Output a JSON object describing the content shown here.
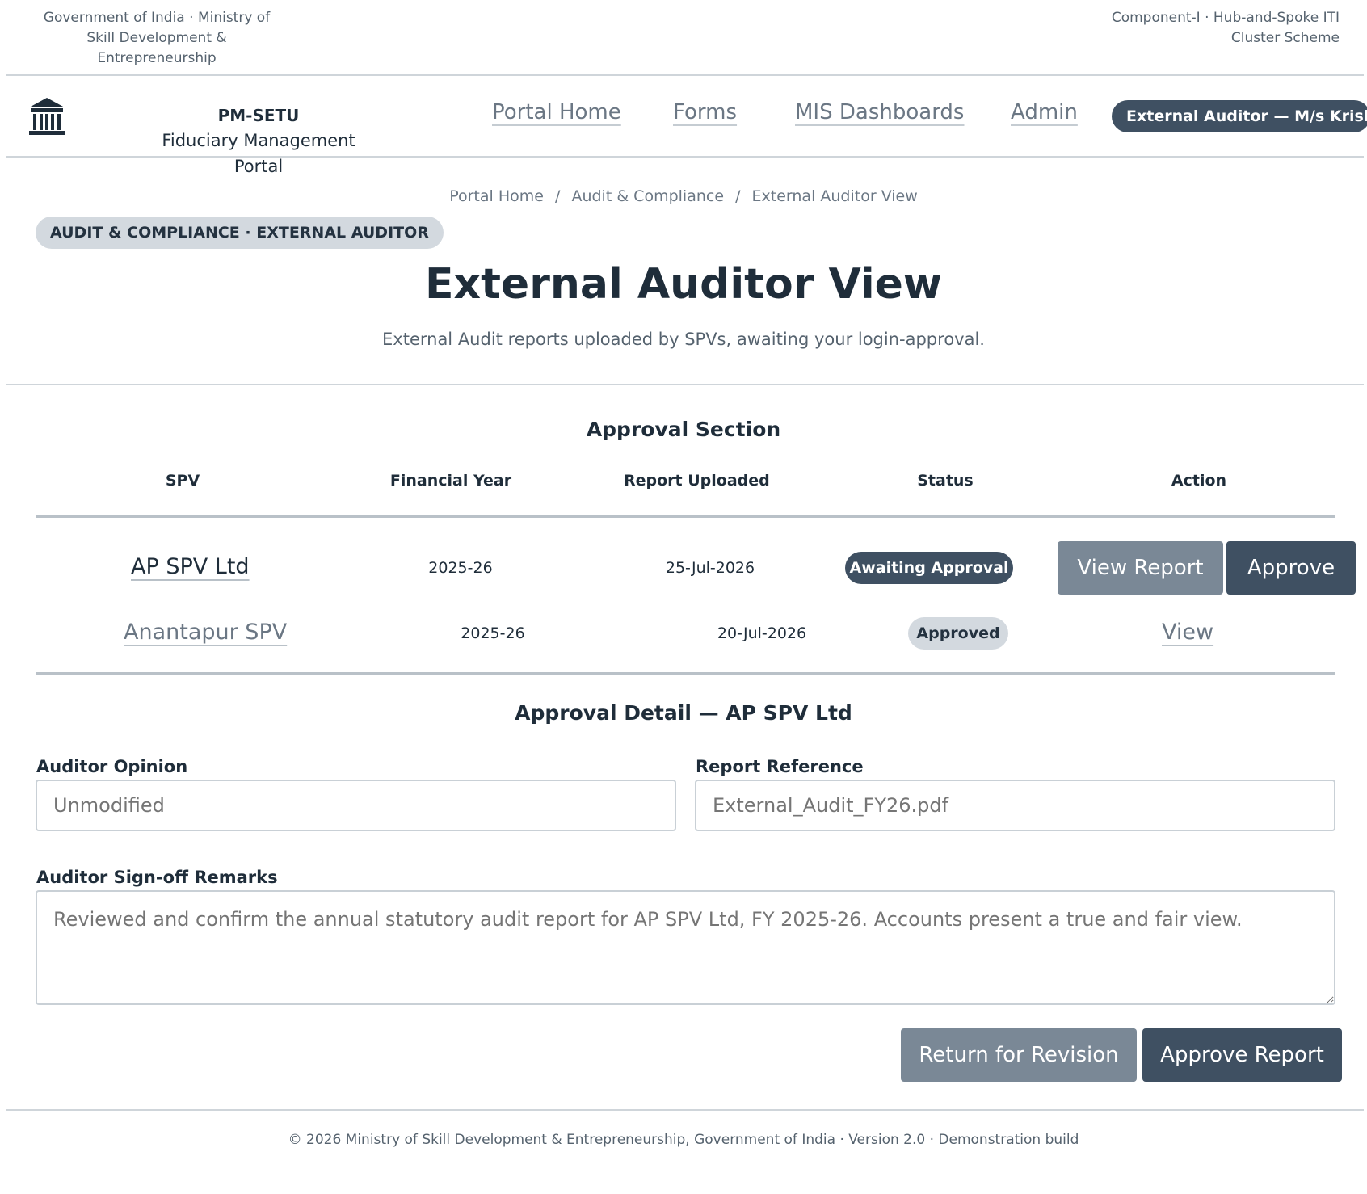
{
  "ministry": {
    "line1": "Government of India · Ministry of",
    "line2": "Skill Development &",
    "line3": "Entrepreneurship"
  },
  "scheme": {
    "line1": "Component-I · Hub-and-Spoke ITI",
    "line2": "Cluster Scheme"
  },
  "brand": {
    "name": "PM-SETU",
    "portal": "Fiduciary Management Portal",
    "logo_icon": "government-building-icon"
  },
  "nav": {
    "items": [
      "Portal Home",
      "Forms",
      "MIS Dashboards",
      "Admin"
    ],
    "user_role": "External Auditor — M/s Krishna"
  },
  "breadcrumb": {
    "items": [
      "Portal Home",
      "Audit & Compliance",
      "External Auditor View"
    ],
    "separator": "/"
  },
  "page": {
    "tag": "AUDIT & COMPLIANCE · EXTERNAL AUDITOR",
    "title": "External Auditor View",
    "subtitle": "External Audit reports uploaded by SPVs, awaiting your login-approval."
  },
  "approval_section": {
    "title": "Approval Section",
    "columns": [
      "SPV",
      "Financial Year",
      "Report Uploaded",
      "Status",
      "Action"
    ],
    "rows": [
      {
        "spv": "AP SPV Ltd",
        "financial_year": "2025-26",
        "report_uploaded": "25-Jul-2026",
        "status": "Awaiting Approval",
        "actions": [
          "View Report",
          "Approve"
        ]
      },
      {
        "spv": "Anantapur SPV",
        "financial_year": "2025-26",
        "report_uploaded": "20-Jul-2026",
        "status": "Approved",
        "actions": [
          "View"
        ]
      }
    ]
  },
  "approval_detail": {
    "title": "Approval Detail — AP SPV Ltd",
    "auditor_opinion": {
      "label": "Auditor Opinion",
      "placeholder": "Unmodified"
    },
    "report_reference": {
      "label": "Report Reference",
      "placeholder": "External_Audit_FY26.pdf"
    },
    "remarks": {
      "label": "Auditor Sign-off Remarks",
      "placeholder": "Reviewed and confirm the annual statutory audit report for AP SPV Ltd, FY 2025-26. Accounts present a true and fair view."
    },
    "buttons": {
      "return": "Return for Revision",
      "approve": "Approve Report"
    }
  },
  "footer": {
    "text": "© 2026 Ministry of Skill Development & Entrepreneurship, Government of India · Version 2.0 · Demonstration build"
  },
  "colors": {
    "primary_dark": "#3f5062",
    "secondary_grey": "#7a8896",
    "badge_approved_bg": "#d3d9df",
    "rule": "#cfd5da"
  }
}
